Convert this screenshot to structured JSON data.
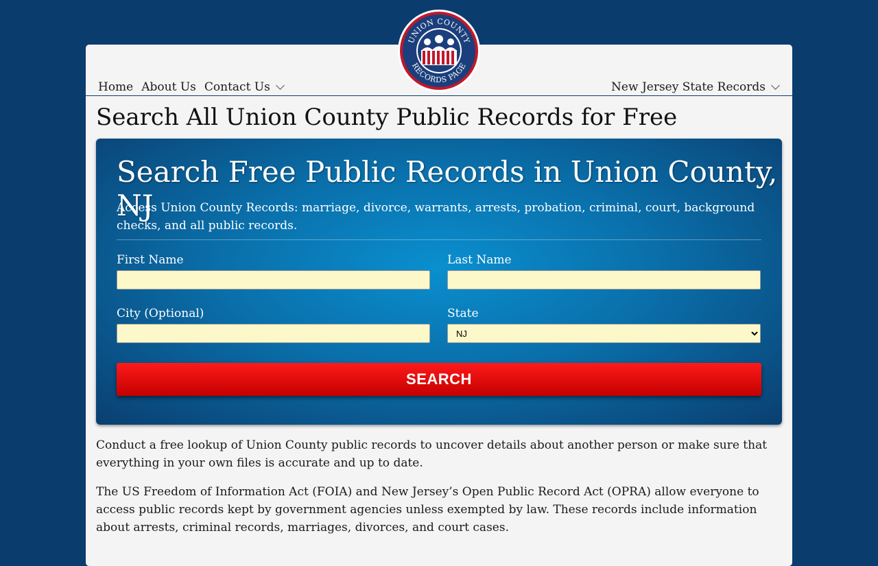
{
  "colors": {
    "background": "#0b3c6e",
    "panel": "#f4f4f4",
    "search_gradient": "#0a8fcf",
    "search_button": "#e00000",
    "input_bg": "#fdf8c9"
  },
  "logo": {
    "icon": "union-county-records-seal-icon",
    "text_top": "UNION COUNTY",
    "text_bottom": "RECORDS PAGE"
  },
  "nav": {
    "items": [
      {
        "label": "Home"
      },
      {
        "label": "About Us"
      },
      {
        "label": "Contact Us",
        "icon": "chevron-down-icon"
      }
    ],
    "right": {
      "label": "New Jersey State Records",
      "icon": "chevron-down-icon"
    }
  },
  "main": {
    "title": "Search All Union County Public Records for Free"
  },
  "search": {
    "heading": "Search Free Public Records in Union County, NJ",
    "description": "Access Union County Records: marriage, divorce, warrants, arrests, probation, criminal, court, background checks, and all public records.",
    "first_name_label": "First Name",
    "first_name_value": "",
    "last_name_label": "Last Name",
    "last_name_value": "",
    "city_label": "City (Optional)",
    "city_value": "",
    "state_label": "State",
    "state_selected": "NJ",
    "button_label": "SEARCH"
  },
  "content": {
    "paragraph_1": "Conduct a free lookup of Union County public records to uncover details about another person or make sure that everything in your own files is accurate and up to date.",
    "paragraph_2": "The US Freedom of Information Act (FOIA) and New Jersey’s Open Public Record Act (OPRA) allow everyone to access public records kept by government agencies unless exempted by law. These records include information about arrests, criminal records, marriages, divorces, and court cases."
  }
}
